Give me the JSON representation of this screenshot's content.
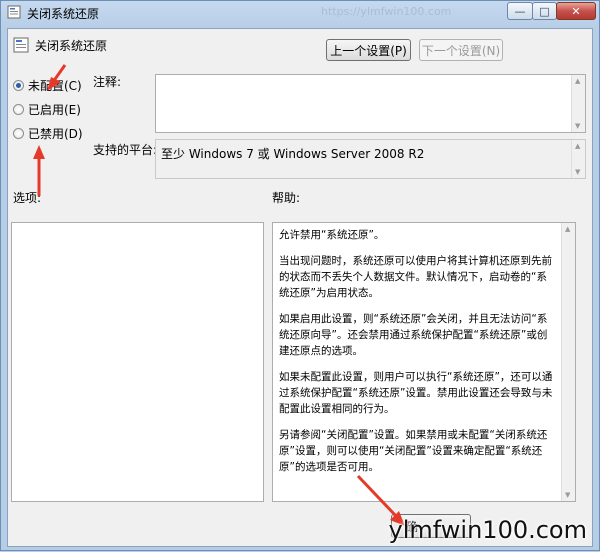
{
  "window": {
    "title": "关闭系统还原",
    "watermark_url": "https://ylmfwin100.com"
  },
  "header": {
    "policy_name": "关闭系统还原"
  },
  "nav": {
    "prev_label": "上一个设置(P)",
    "next_label": "下一个设置(N)"
  },
  "radios": [
    {
      "label": "未配置(C)",
      "checked": true
    },
    {
      "label": "已启用(E)",
      "checked": false
    },
    {
      "label": "已禁用(D)",
      "checked": false
    }
  ],
  "comment": {
    "label": "注释:",
    "value": ""
  },
  "platform": {
    "label": "支持的平台:",
    "value": "至少 Windows 7 或 Windows Server 2008 R2"
  },
  "options": {
    "label": "选项:"
  },
  "help": {
    "label": "帮助:",
    "paragraphs": [
      "允许禁用“系统还原”。",
      "当出现问题时，系统还原可以使用户将其计算机还原到先前的状态而不丢失个人数据文件。默认情况下，启动卷的“系统还原”为启用状态。",
      "如果启用此设置，则“系统还原”会关闭，并且无法访问“系统还原向导”。还会禁用通过系统保护配置“系统还原”或创建还原点的选项。",
      "如果未配置此设置，则用户可以执行“系统还原”，还可以通过系统保护配置“系统还原”设置。禁用此设置还会导致与未配置此设置相同的行为。",
      "另请参阅“关闭配置”设置。如果禁用或未配置“关闭系统还原”设置，则可以使用“关闭配置”设置来确定配置“系统还原”的选项是否可用。"
    ]
  },
  "footer": {
    "ok_label": "确"
  },
  "watermark": {
    "text": "ylmfwin100.com"
  },
  "colors": {
    "arrow": "#e53a2a",
    "radio_selected": "#2a5ea8"
  }
}
